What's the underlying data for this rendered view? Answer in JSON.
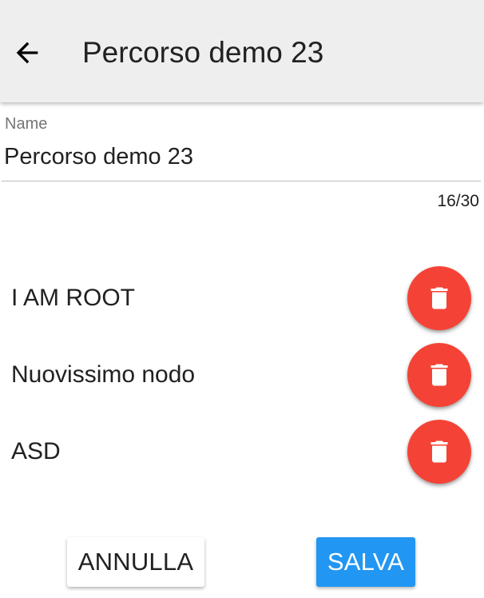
{
  "appbar": {
    "title": "Percorso demo 23",
    "back_icon": "arrow-left-icon"
  },
  "name_field": {
    "label": "Name",
    "value": "Percorso demo 23",
    "counter": "16/30"
  },
  "nodes": [
    {
      "label": "I AM ROOT",
      "action_icon": "trash-icon"
    },
    {
      "label": "Nuovissimo nodo",
      "action_icon": "trash-icon"
    },
    {
      "label": "ASD",
      "action_icon": "trash-icon"
    }
  ],
  "actions": {
    "cancel_label": "ANNULLA",
    "save_label": "SALVA"
  },
  "colors": {
    "appbar_bg": "#eeeeee",
    "delete_fab": "#f44336",
    "save_button": "#2196f3"
  }
}
